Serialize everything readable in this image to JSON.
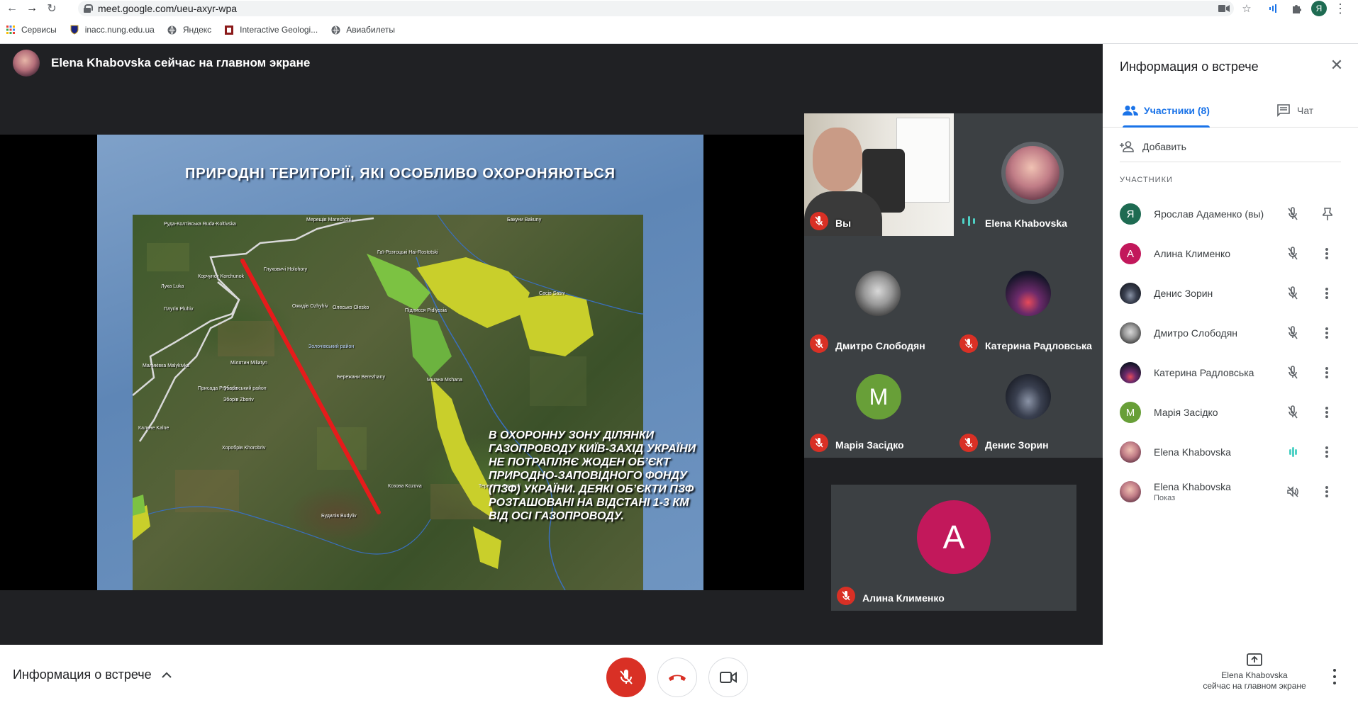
{
  "browser": {
    "url": "meet.google.com/ueu-axyr-wpa",
    "profile_initial": "Я",
    "bookmarks": [
      "Сервисы",
      "inacc.nung.edu.ua",
      "Яндекс",
      "Interactive Geologi...",
      "Авиабилеты"
    ]
  },
  "stage": {
    "presenter_text": "Elena Khabovska сейчас на главном экране",
    "slide": {
      "title": "ПРИРОДНІ ТЕРИТОРІЇ, ЯКІ ОСОБЛИВО ОХОРОНЯЮТЬСЯ",
      "body": "В ОХОРОННУ ЗОНУ ДІЛЯНКИ ГАЗОПРОВОДУ КИЇВ-ЗАХІД УКРАЇНИ НЕ ПОТРАПЛЯЄ ЖОДЕН ОБ’ЄКТ ПРИРОДНО-ЗАПОВІДНОГО ФОНДУ (ПЗФ) УКРАЇНИ. ДЕЯКІ ОБ’ЄКТИ ПЗФ РОЗТАШОВАНІ НА ВІДСТАНІ 1-3 КМ ВІД ОСІ ГАЗОПРОВОДУ.",
      "map_labels": [
        "Руда-Колтівська Ruda-Koltivska",
        "Мерещів Mareshchi",
        "Бакуни Bakuny",
        "Корчунок Korchunok",
        "Гаї-Розтоцькі Hai-Rostotski",
        "Лука Luka",
        "Глуховичі Holohory",
        "Золочівський район",
        "Ожидів Ozhyhiv",
        "Олесько Olesko",
        "Підлисся Pidlyssia",
        "Плугів Pluhiv",
        "Сасів Sasiv",
        "Мшана Mshana",
        "Маликівка Malykivka",
        "Мілятин Miliatyn",
        "Зборівський район",
        "Присада Prysada",
        "Зборів Zboriv",
        "Кальне Kalne",
        "Хоробрів Khorobriv",
        "Тернопіль Ternopil",
        "Козова Kozova",
        "Будилів Budyliv",
        "Бережани Berezhany"
      ]
    }
  },
  "tiles": [
    {
      "name": "Вы",
      "state": "muted"
    },
    {
      "name": "Elena Khabovska",
      "state": "speaking"
    },
    {
      "name": "Дмитро Слободян",
      "state": "muted"
    },
    {
      "name": "Катерина Радловська",
      "state": "muted"
    },
    {
      "name": "Марія Засідко",
      "initial": "М",
      "state": "muted"
    },
    {
      "name": "Денис Зорин",
      "state": "muted"
    },
    {
      "name": "Алина Клименко",
      "initial": "А",
      "state": "muted"
    }
  ],
  "panel": {
    "title": "Информация о встрече",
    "tab_people": "Участники (8)",
    "tab_chat": "Чат",
    "add_label": "Добавить",
    "section_label": "УЧАСТНИКИ",
    "participants": [
      {
        "name": "Ярослав Адаменко (вы)",
        "initial": "Я",
        "color": "#1e6b52",
        "action": "pin"
      },
      {
        "name": "Алина Клименко",
        "initial": "А",
        "color": "#c2185b",
        "action": "more"
      },
      {
        "name": "Денис Зорин",
        "initial": "",
        "color": "#2b2f3a",
        "action": "more"
      },
      {
        "name": "Дмитро Слободян",
        "initial": "",
        "color": "#6a6a6a",
        "action": "more"
      },
      {
        "name": "Катерина Радловська",
        "initial": "",
        "color": "#2a1f3d",
        "action": "more"
      },
      {
        "name": "Марія Засідко",
        "initial": "М",
        "color": "#689f38",
        "action": "more"
      },
      {
        "name": "Elena Khabovska",
        "initial": "",
        "color": "#a8636f",
        "action": "more",
        "speaking": true
      },
      {
        "name": "Elena Khabovska",
        "sub": "Показ",
        "initial": "",
        "color": "#a8636f",
        "action": "more",
        "presenting": true
      }
    ]
  },
  "bottom": {
    "meeting_info": "Информация о встрече",
    "presenting_line1": "Elena Khabovska",
    "presenting_line2": "сейчас на главном экране"
  },
  "colors": {
    "accent": "#1a73e8",
    "danger": "#d93025",
    "speaking": "#4fd1c5"
  }
}
